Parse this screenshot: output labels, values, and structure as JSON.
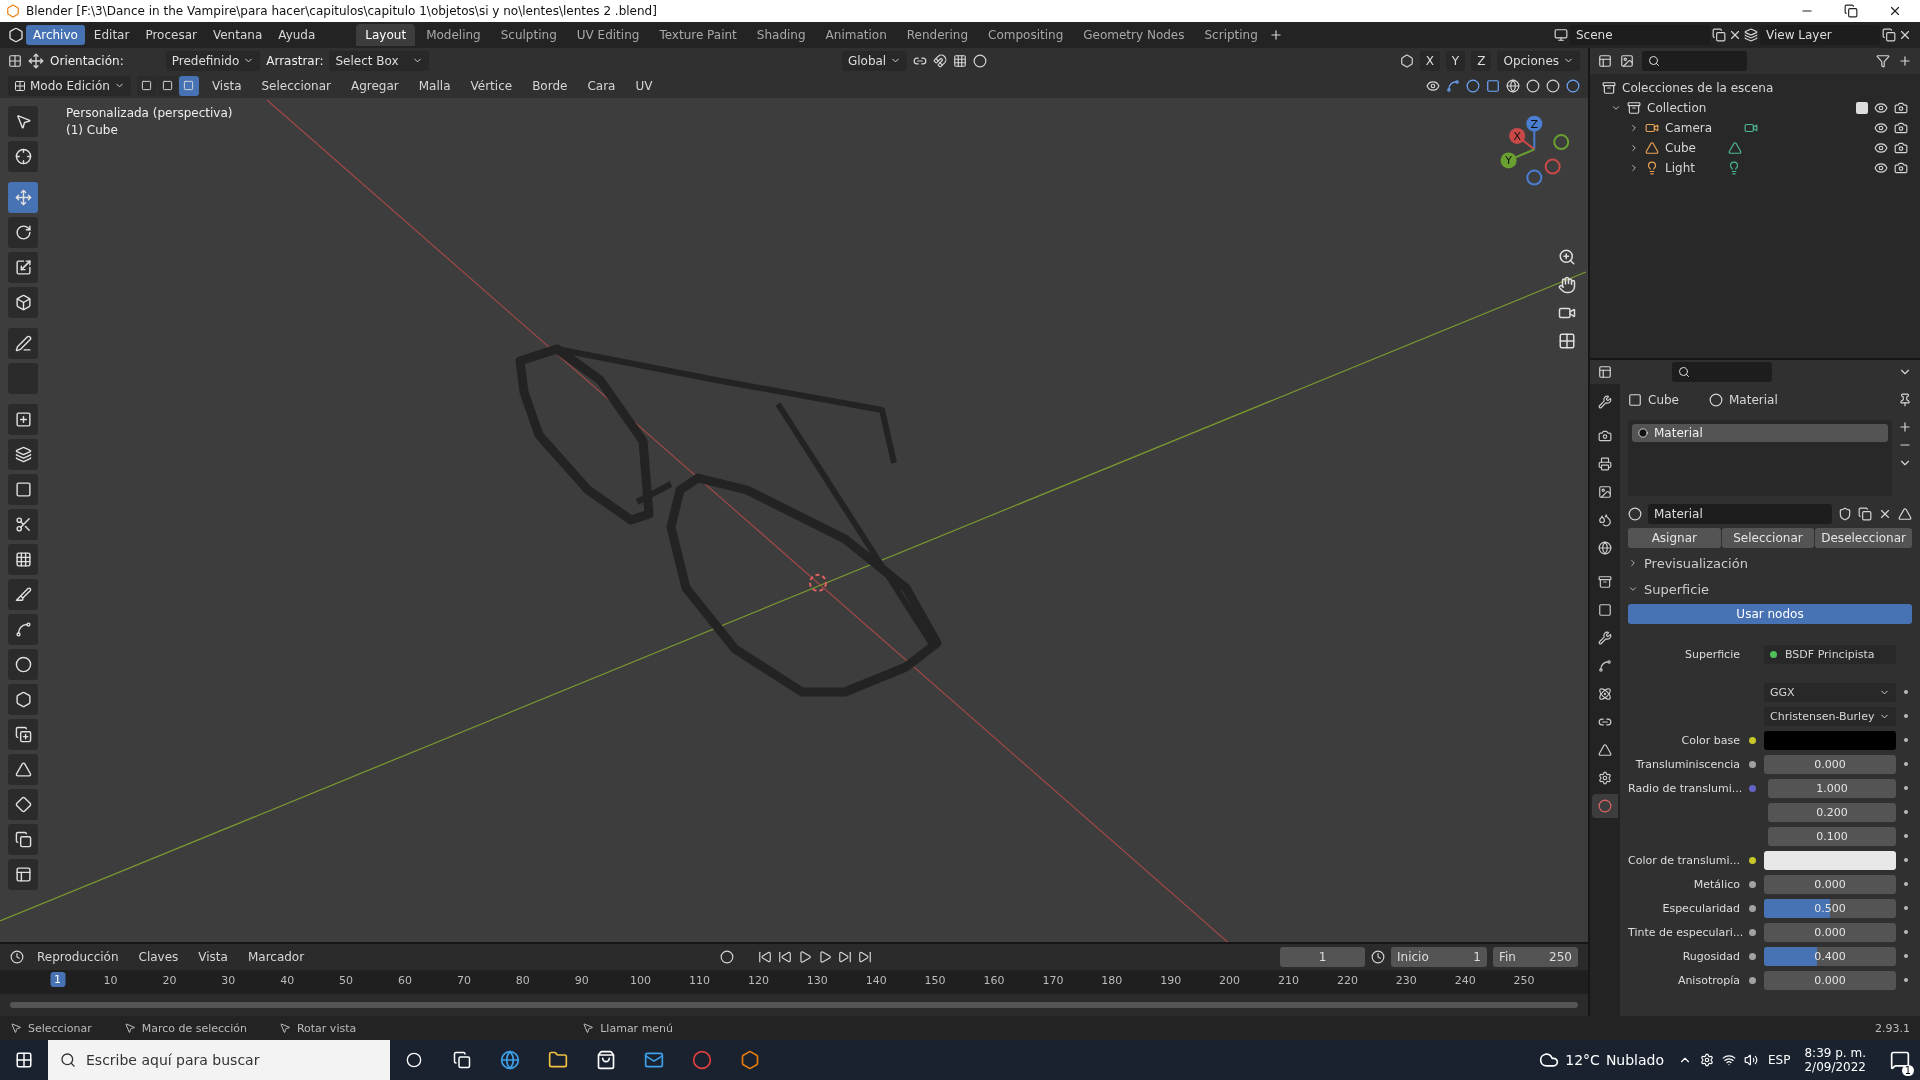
{
  "window": {
    "title": "Blender [F:\\3\\Dance in the Vampire\\para hacer\\capitulos\\capitulo 1\\objetos\\si y no\\lentes\\lentes 2  .blend]"
  },
  "menu": [
    {
      "label": "Archivo",
      "selected": true
    },
    {
      "label": "Editar",
      "selected": false
    },
    {
      "label": "Procesar",
      "selected": false
    },
    {
      "label": "Ventana",
      "selected": false
    },
    {
      "label": "Ayuda",
      "selected": false
    }
  ],
  "workspaces": [
    {
      "label": "Layout",
      "selected": true
    },
    {
      "label": "Modeling",
      "selected": false
    },
    {
      "label": "Sculpting",
      "selected": false
    },
    {
      "label": "UV Editing",
      "selected": false
    },
    {
      "label": "Texture Paint",
      "selected": false
    },
    {
      "label": "Shading",
      "selected": false
    },
    {
      "label": "Animation",
      "selected": false
    },
    {
      "label": "Rendering",
      "selected": false
    },
    {
      "label": "Compositing",
      "selected": false
    },
    {
      "label": "Geometry Nodes",
      "selected": false
    },
    {
      "label": "Scripting",
      "selected": false
    }
  ],
  "scene": "Scene",
  "view_layer": "View Layer",
  "viewport_header": {
    "orientation_label": "Orientación:",
    "pivot": "Predefinido",
    "drag_label": "Arrastrar:",
    "drag_value": "Select Box",
    "transform": "Global",
    "mirror_axes": [
      "X",
      "Y",
      "Z"
    ],
    "options": "Opciones",
    "mode": "Modo Edición",
    "select_modes": [
      {
        "selected": false
      },
      {
        "selected": false
      },
      {
        "selected": true
      }
    ],
    "menus": [
      "Vista",
      "Seleccionar",
      "Agregar",
      "Malla",
      "Vértice",
      "Borde",
      "Cara",
      "UV"
    ]
  },
  "viewport": {
    "view_name": "Personalizada (perspectiva)",
    "object_name": "(1) Cube",
    "gizmo_axes": [
      "X",
      "Y",
      "Z"
    ]
  },
  "tools": [
    {
      "selected": false
    },
    {
      "selected": false
    },
    {
      "selected": true
    },
    {
      "selected": false
    },
    {
      "selected": false
    },
    {
      "selected": false
    },
    {
      "selected": false
    },
    {
      "selected": false
    },
    {
      "selected": false
    },
    {
      "selected": false
    },
    {
      "selected": false
    },
    {
      "selected": false
    },
    {
      "selected": false
    },
    {
      "selected": false
    },
    {
      "selected": false
    },
    {
      "selected": false
    },
    {
      "selected": false
    },
    {
      "selected": false
    },
    {
      "selected": false
    },
    {
      "selected": false
    },
    {
      "selected": false
    },
    {
      "selected": false
    }
  ],
  "outliner": {
    "root": "Colecciones de la escena",
    "collection": {
      "label": "Collection",
      "checked": true,
      "children": [
        {
          "label": "Camera",
          "kind": "camera"
        },
        {
          "label": "Cube",
          "kind": "mesh"
        },
        {
          "label": "Light",
          "kind": "light"
        }
      ]
    }
  },
  "properties": {
    "tabs": [
      {
        "selected": false
      },
      {
        "selected": false
      },
      {
        "selected": false
      },
      {
        "selected": false
      },
      {
        "selected": false
      },
      {
        "selected": false
      },
      {
        "selected": false
      },
      {
        "selected": false
      },
      {
        "selected": false
      },
      {
        "selected": false
      },
      {
        "selected": false
      },
      {
        "selected": false
      },
      {
        "selected": false
      },
      {
        "selected": false
      },
      {
        "selected": true
      }
    ],
    "breadcrumb": [
      "Cube",
      "Material"
    ],
    "slots": [
      {
        "label": "Material",
        "selected": true
      }
    ],
    "material_name": "Material",
    "buttons": [
      "Asignar",
      "Seleccionar",
      "Deseleccionar"
    ],
    "panels": [
      {
        "label": "Previsualización",
        "expanded": false
      },
      {
        "label": "Superficie",
        "expanded": true
      }
    ],
    "use_nodes": "Usar nodos",
    "fields": [
      {
        "kind": "link",
        "label": "Superficie",
        "value": "BSDF Principista"
      },
      {
        "kind": "dropdown",
        "value": "GGX"
      },
      {
        "kind": "dropdown",
        "value": "Christensen-Burley"
      },
      {
        "kind": "swatch",
        "label": "Color base",
        "color": "#000000"
      },
      {
        "kind": "number",
        "label": "Transluminiscencia",
        "value": "0.000"
      },
      {
        "kind": "vector",
        "label": "Radio de translumi...",
        "values": [
          "1.000",
          "0.200",
          "0.100"
        ]
      },
      {
        "kind": "swatch",
        "label": "Color de translumi...",
        "color": "#e8e8e8"
      },
      {
        "kind": "number",
        "label": "Metálico",
        "value": "0.000"
      },
      {
        "kind": "slider",
        "label": "Especularidad",
        "value": "0.500",
        "level": 0.5
      },
      {
        "kind": "number",
        "label": "Tinte de especulari...",
        "value": "0.000"
      },
      {
        "kind": "slider",
        "label": "Rugosidad",
        "value": "0.400",
        "level": 0.4
      },
      {
        "kind": "number",
        "label": "Anisotropía",
        "value": "0.000"
      }
    ]
  },
  "timeline": {
    "menus": [
      "Reproducción",
      "Claves",
      "Vista",
      "Marcador"
    ],
    "current_frame": "1",
    "start_label": "Inicio",
    "start": "1",
    "end_label": "Fin",
    "end": "250",
    "playhead": "1",
    "ticks": [
      "10",
      "20",
      "30",
      "40",
      "50",
      "60",
      "70",
      "80",
      "90",
      "100",
      "110",
      "120",
      "130",
      "140",
      "150",
      "160",
      "170",
      "180",
      "190",
      "200",
      "210",
      "220",
      "230",
      "240",
      "250"
    ]
  },
  "status_bar": {
    "hints": [
      "Seleccionar",
      "Marco de selección",
      "Rotar vista",
      "Llamar menú"
    ],
    "version": "2.93.1"
  },
  "taskbar": {
    "search_placeholder": "Escribe aquí para buscar",
    "temperature": "12°C",
    "weather": "Nublado",
    "language": "ESP",
    "time": "8:39 p. m.",
    "date": "2/09/2022",
    "notifications": "1"
  }
}
